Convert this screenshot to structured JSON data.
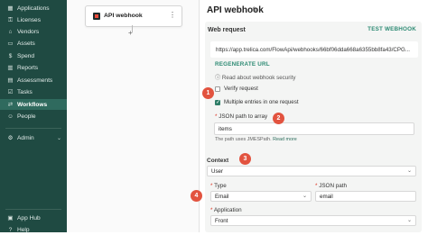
{
  "sidebar": {
    "items": [
      {
        "label": "Applications",
        "icon": "grid-icon"
      },
      {
        "label": "Licenses",
        "icon": "key-icon"
      },
      {
        "label": "Vendors",
        "icon": "store-icon"
      },
      {
        "label": "Assets",
        "icon": "laptop-icon"
      },
      {
        "label": "Spend",
        "icon": "dollar-icon"
      },
      {
        "label": "Reports",
        "icon": "chart-icon"
      },
      {
        "label": "Assessments",
        "icon": "clipboard-icon"
      },
      {
        "label": "Tasks",
        "icon": "checklist-icon"
      },
      {
        "label": "Workflows",
        "icon": "flow-icon"
      },
      {
        "label": "People",
        "icon": "people-icon"
      }
    ],
    "admin_label": "Admin",
    "app_hub_label": "App Hub",
    "help_label": "Help"
  },
  "canvas": {
    "node_title": "API webhook",
    "add_symbol": "+"
  },
  "panel": {
    "title": "API webhook",
    "web_request_label": "Web request",
    "test_label": "TEST WEBHOOK",
    "url": "https://app.trelica.com/FlowApi/webhooks/66bf06dda668a6355bb8fa43/CPG...",
    "regenerate_label": "REGENERATE URL",
    "read_about": "Read about webhook security",
    "verify_label": "Verify request",
    "multiple_label": "Multiple entries in one request",
    "json_path_label": "JSON path to array",
    "json_path_value": "items",
    "hint_prefix": "The path uses JMESPath.",
    "hint_link": "Read more",
    "context_title": "Context",
    "context_value": "User",
    "type_label": "Type",
    "type_value": "Email",
    "json_path2_label": "JSON path",
    "json_path2_value": "email",
    "application_label": "Application",
    "application_value": "Front"
  },
  "badges": [
    "1",
    "2",
    "3",
    "4"
  ],
  "colors": {
    "sidebar": "#1f4a42",
    "accent": "#2e8b74",
    "badge": "#e2533f"
  }
}
